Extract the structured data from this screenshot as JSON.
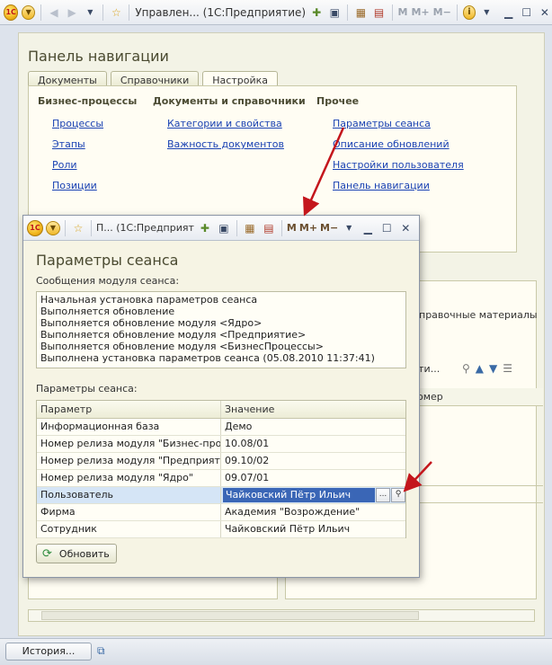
{
  "app": {
    "window_title": "Управлен... (1С:Предприятие)",
    "logo_text": "1С",
    "m_labels": [
      "M",
      "M+",
      "M−"
    ]
  },
  "nav": {
    "title": "Панель навигации",
    "tabs": [
      {
        "label": "Документы"
      },
      {
        "label": "Справочники"
      },
      {
        "label": "Настройка"
      }
    ],
    "columns": [
      {
        "header": "Бизнес-процессы",
        "links": [
          "Процессы",
          "Этапы",
          "Роли",
          "Позиции"
        ]
      },
      {
        "header": "Документы и справочники",
        "links": [
          "Категории и свойства",
          "Важность документов"
        ]
      },
      {
        "header": "Прочее",
        "links": [
          "Параметры сеанса",
          "Описание обновлений",
          "Настройки пользователя",
          "Панель навигации"
        ]
      }
    ]
  },
  "background": {
    "link_partial": "правочные материалы",
    "toolbar_partial": "йти...",
    "column_partial": "омер"
  },
  "dialog": {
    "window_title": "П... (1С:Предприят",
    "title": "Параметры сеанса",
    "messages_label": "Сообщения модуля сеанса:",
    "messages": [
      "Начальная установка параметров сеанса",
      "Выполняется обновление",
      "Выполняется обновление модуля <Ядро>",
      "Выполняется обновление модуля <Предприятие>",
      "Выполняется обновление модуля <БизнесПроцессы>",
      "Выполнена установка параметров сеанса (05.08.2010 11:37:41)"
    ],
    "params_label": "Параметры сеанса:",
    "columns": [
      "Параметр",
      "Значение"
    ],
    "rows": [
      {
        "param": "Информационная база",
        "value": "Демо"
      },
      {
        "param": "Номер релиза модуля \"Бизнес-проц...",
        "value": "10.08/01"
      },
      {
        "param": "Номер релиза модуля \"Предприятие\"",
        "value": "09.10/02"
      },
      {
        "param": "Номер релиза модуля \"Ядро\"",
        "value": "09.07/01"
      },
      {
        "param": "Пользователь",
        "value": "Чайковский Пётр Ильич"
      },
      {
        "param": "Фирма",
        "value": "Академия \"Возрождение\""
      },
      {
        "param": "Сотрудник",
        "value": "Чайковский Пётр Ильич"
      }
    ],
    "selected_row": 4,
    "ellipsis": "...",
    "refresh_label": "Обновить"
  },
  "taskbar": {
    "history_label": "История..."
  },
  "colors": {
    "link": "#1a42b3",
    "arrow": "#c4161c",
    "selection": "#3a66b6"
  }
}
